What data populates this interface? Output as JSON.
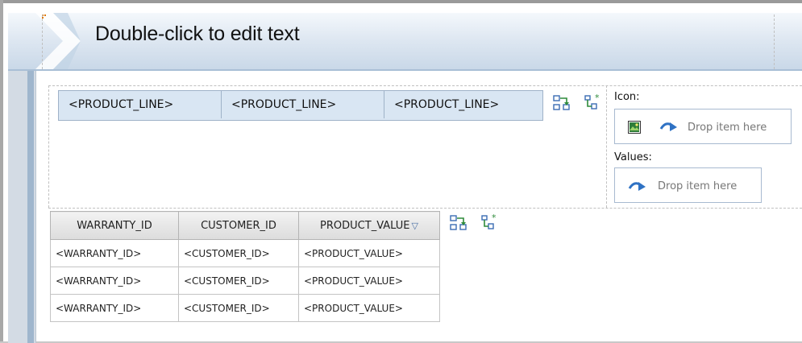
{
  "header": {
    "title": "Double-click to edit text"
  },
  "crosstab": {
    "columns": [
      "<PRODUCT_LINE>",
      "<PRODUCT_LINE>",
      "<PRODUCT_LINE>"
    ]
  },
  "side_panel": {
    "icon_label": "Icon:",
    "values_label": "Values:",
    "drop_text": "Drop item here"
  },
  "list": {
    "headers": [
      "WARRANTY_ID",
      "CUSTOMER_ID",
      "PRODUCT_VALUE"
    ],
    "rows": [
      [
        "<WARRANTY_ID>",
        "<CUSTOMER_ID>",
        "<PRODUCT_VALUE>"
      ],
      [
        "<WARRANTY_ID>",
        "<CUSTOMER_ID>",
        "<PRODUCT_VALUE>"
      ],
      [
        "<WARRANTY_ID>",
        "<CUSTOMER_ID>",
        "<PRODUCT_VALUE>"
      ]
    ]
  },
  "colors": {
    "header_band": "#dfe8f2",
    "crosstab_fill": "#d9e6f3",
    "handle": "#e07a00",
    "drop_arrow": "#2f72c4"
  },
  "icons": [
    "group-icon",
    "insert-calculation-icon",
    "image-icon",
    "drop-arrow-icon",
    "sort-descending-icon"
  ]
}
